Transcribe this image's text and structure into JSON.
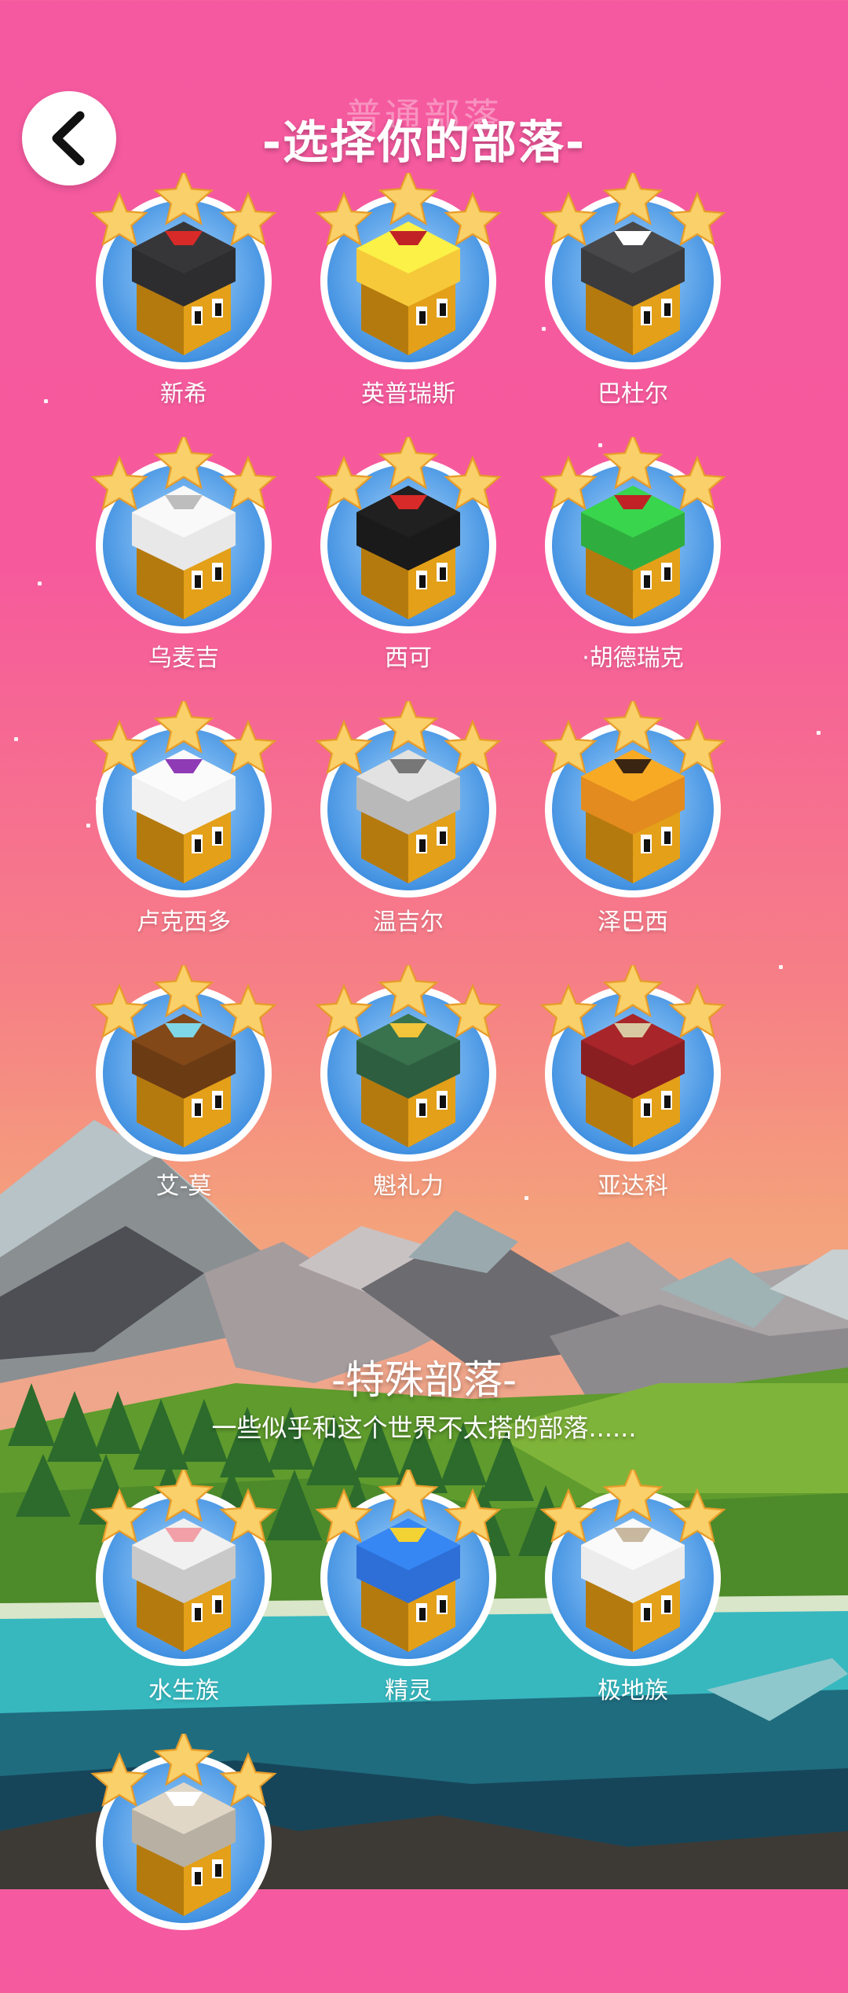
{
  "header": {
    "ghost_text": "普通部落",
    "title": "-选择你的部落-"
  },
  "tribes": [
    {
      "name": "新希",
      "icon": "xin-xi-tribe-icon",
      "helmet": "#2d2d2f",
      "accent": "#d82a28"
    },
    {
      "name": "英普瑞斯",
      "icon": "imperius-tribe-icon",
      "helmet": "#f6c93a",
      "accent": "#c02226"
    },
    {
      "name": "巴杜尔",
      "icon": "bardur-tribe-icon",
      "helmet": "#3b3b3d",
      "accent": "#ffffff"
    },
    {
      "name": "乌麦吉",
      "icon": "oumaji-tribe-icon",
      "helmet": "#e8e8e8",
      "accent": "#bdbdbd"
    },
    {
      "name": "西可",
      "icon": "kickoo-tribe-icon",
      "helmet": "#1a1a1a",
      "accent": "#d82a28"
    },
    {
      "name": "·胡德瑞克",
      "icon": "hoodrick-tribe-icon",
      "helmet": "#2fae3f",
      "accent": "#c02226"
    },
    {
      "name": "卢克西多",
      "icon": "luxidoor-tribe-icon",
      "helmet": "#f1f1f1",
      "accent": "#8e3bb5"
    },
    {
      "name": "温吉尔",
      "icon": "vengir-tribe-icon",
      "helmet": "#b9b9b9",
      "accent": "#777777"
    },
    {
      "name": "泽巴西",
      "icon": "zebasi-tribe-icon",
      "helmet": "#e38b1f",
      "accent": "#3a2412"
    },
    {
      "name": "艾-莫",
      "icon": "ai-mo-tribe-icon",
      "helmet": "#6b3b14",
      "accent": "#7fd6e6"
    },
    {
      "name": "魁礼力",
      "icon": "quetzali-tribe-icon",
      "helmet": "#2e5e40",
      "accent": "#f2c53a"
    },
    {
      "name": "亚达科",
      "icon": "yadakk-tribe-icon",
      "helmet": "#8a1f22",
      "accent": "#d9c9a3"
    }
  ],
  "special_section": {
    "title": "-特殊部落-",
    "subtitle": "一些似乎和这个世界不太搭的部落......"
  },
  "special_tribes": [
    {
      "name": "水生族",
      "icon": "aquarion-tribe-icon",
      "helmet": "#c9c9c9",
      "accent": "#f2a0a8"
    },
    {
      "name": "精灵",
      "icon": "elyrion-tribe-icon",
      "helmet": "#2d6fd6",
      "accent": "#f3d234"
    },
    {
      "name": "极地族",
      "icon": "polaris-tribe-icon",
      "helmet": "#ececec",
      "accent": "#c9b8a0"
    },
    {
      "name": "",
      "icon": "cymanti-tribe-icon",
      "helmet": "#b8b0a2",
      "accent": "#ffffff"
    }
  ],
  "colors": {
    "sky_top": "#f55aa0",
    "badge_blue": "#3f8fe0",
    "star_gold": "#f4c04a",
    "water": "#2ea8b2"
  }
}
